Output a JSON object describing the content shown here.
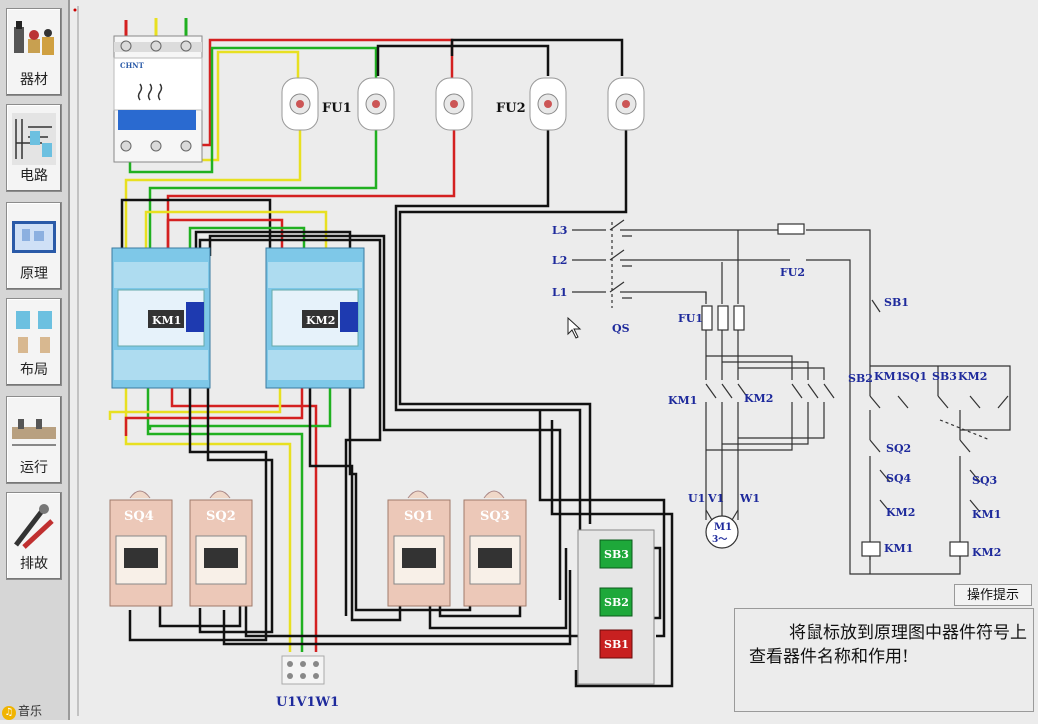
{
  "sidebar": {
    "items": [
      {
        "label": "器材",
        "icon": "equipment-icon"
      },
      {
        "label": "电路",
        "icon": "circuit-icon"
      },
      {
        "label": "原理",
        "icon": "schematic-icon"
      },
      {
        "label": "布局",
        "icon": "layout-icon"
      },
      {
        "label": "运行",
        "icon": "run-icon"
      },
      {
        "label": "排故",
        "icon": "troubleshoot-icon"
      }
    ],
    "music_label": "音乐",
    "music_icon": "music-note-icon"
  },
  "wiring": {
    "fuse_group_1": "FU1",
    "fuse_group_2": "FU2",
    "contactor_1": "KM1",
    "contactor_2": "KM2",
    "breaker_brand": "CHNT",
    "limit_switches": [
      "SQ4",
      "SQ2",
      "SQ1",
      "SQ3"
    ],
    "buttons": [
      "SB3",
      "SB2",
      "SB1"
    ],
    "terminal_label": "U1V1W1",
    "wire_colors": {
      "phase_a": "#d42020",
      "phase_b": "#e8e020",
      "phase_c": "#20b020",
      "control": "#111111"
    }
  },
  "schematic": {
    "lines": [
      "L3",
      "L2",
      "L1"
    ],
    "qs": "QS",
    "fu1": "FU1",
    "fu2": "FU2",
    "km1": "KM1",
    "km2": "KM2",
    "terminals": [
      "U1",
      "V1",
      "W1"
    ],
    "motor": "M1",
    "motor_sub": "3～",
    "sb1": "SB1",
    "row_labels": [
      "SB2",
      "KM1",
      "SQ1",
      "SB3",
      "KM2"
    ],
    "sq2": "SQ2",
    "sq4": "SQ4",
    "sq3": "SQ3",
    "coil_km1": "KM1",
    "coil_km2": "KM2",
    "contact_km2": "KM2",
    "contact_km1": "KM1"
  },
  "tip": {
    "button_label": "操作提示",
    "text": "将鼠标放到原理图中器件符号上查看器件名称和作用!"
  }
}
